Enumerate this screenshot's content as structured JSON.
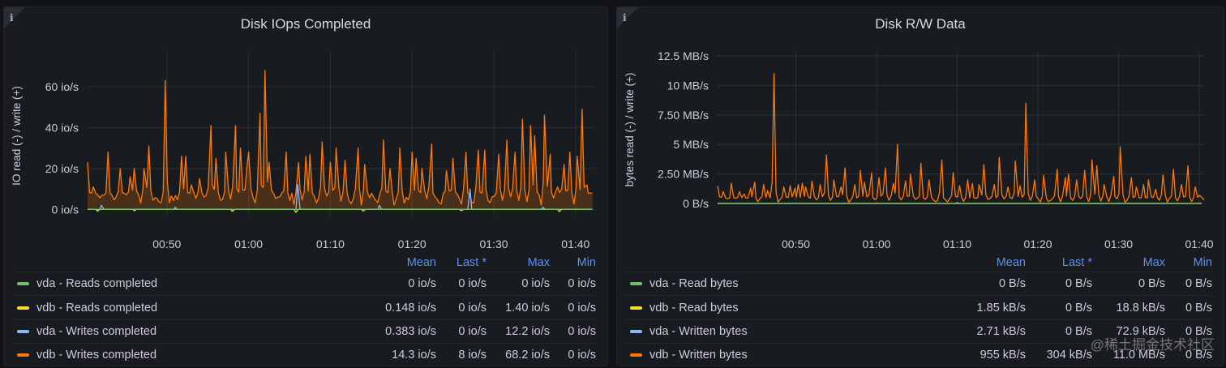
{
  "panels": [
    {
      "title": "Disk IOps Completed",
      "y_label": "IO read (-) / write (+)",
      "legend_headers": {
        "mean": "Mean",
        "last": "Last *",
        "max": "Max",
        "min": "Min"
      },
      "series": [
        {
          "name": "vda - Reads completed",
          "color": "#73bf69",
          "mean": "0 io/s",
          "last": "0 io/s",
          "max": "0 io/s",
          "min": "0 io/s"
        },
        {
          "name": "vdb - Reads completed",
          "color": "#fade2a",
          "mean": "0.148 io/s",
          "last": "0 io/s",
          "max": "1.40 io/s",
          "min": "0 io/s"
        },
        {
          "name": "vda - Writes completed",
          "color": "#8ab8ff",
          "mean": "0.383 io/s",
          "last": "0 io/s",
          "max": "12.2 io/s",
          "min": "0 io/s"
        },
        {
          "name": "vdb - Writes completed",
          "color": "#ff780a",
          "mean": "14.3 io/s",
          "last": "8 io/s",
          "max": "68.2 io/s",
          "min": "0 io/s"
        }
      ]
    },
    {
      "title": "Disk R/W Data",
      "y_label": "bytes read (-) / write (+)",
      "legend_headers": {
        "mean": "Mean",
        "last": "Last *",
        "max": "Max",
        "min": "Min"
      },
      "series": [
        {
          "name": "vda - Read bytes",
          "color": "#73bf69",
          "mean": "0 B/s",
          "last": "0 B/s",
          "max": "0 B/s",
          "min": "0 B/s"
        },
        {
          "name": "vdb - Read bytes",
          "color": "#fade2a",
          "mean": "1.85 kB/s",
          "last": "0 B/s",
          "max": "18.8 kB/s",
          "min": "0 B/s"
        },
        {
          "name": "vda - Written bytes",
          "color": "#8ab8ff",
          "mean": "2.71 kB/s",
          "last": "0 B/s",
          "max": "72.9 kB/s",
          "min": "0 B/s"
        },
        {
          "name": "vdb - Written bytes",
          "color": "#ff780a",
          "mean": "955 kB/s",
          "last": "304 kB/s",
          "max": "11.0 MB/s",
          "min": "0 B/s"
        }
      ]
    }
  ],
  "chart_data": [
    {
      "type": "area",
      "title": "Disk IOps Completed",
      "ylabel": "IO read (-) / write (+)",
      "y_ticks": [
        "0 io/s",
        "20 io/s",
        "40 io/s",
        "60 io/s"
      ],
      "ylim": [
        -3,
        75
      ],
      "x_ticks": [
        "00:50",
        "01:00",
        "01:10",
        "01:20",
        "01:30",
        "01:40"
      ],
      "x_tick_minutes": [
        50,
        60,
        70,
        80,
        90,
        100
      ],
      "xlim": [
        40.2,
        102.3
      ],
      "series": [
        {
          "name": "vdb - Writes completed",
          "color": "#ff780a",
          "fill": true,
          "peaks": [
            [
              40.3,
              23
            ],
            [
              41.0,
              11
            ],
            [
              42.8,
              28
            ],
            [
              44.3,
              20
            ],
            [
              45.5,
              16
            ],
            [
              46.0,
              20
            ],
            [
              47.2,
              20
            ],
            [
              47.8,
              31
            ],
            [
              49.8,
              63
            ],
            [
              51.8,
              26
            ],
            [
              52.3,
              26
            ],
            [
              53.0,
              12
            ],
            [
              54.0,
              15
            ],
            [
              55.4,
              41
            ],
            [
              56.0,
              25
            ],
            [
              57.2,
              28
            ],
            [
              58.4,
              41
            ],
            [
              59.0,
              30
            ],
            [
              59.8,
              21
            ],
            [
              60.0,
              28
            ],
            [
              61.4,
              47
            ],
            [
              62.0,
              68
            ],
            [
              62.5,
              23
            ],
            [
              64.6,
              28
            ],
            [
              66.1,
              23
            ],
            [
              67.0,
              26
            ],
            [
              67.5,
              27
            ],
            [
              69.0,
              33
            ],
            [
              70.0,
              23
            ],
            [
              70.7,
              30
            ],
            [
              71.8,
              24
            ],
            [
              73.4,
              30
            ],
            [
              74.2,
              22
            ],
            [
              76.5,
              34
            ],
            [
              77.3,
              20
            ],
            [
              78.5,
              30
            ],
            [
              80.0,
              28
            ],
            [
              80.5,
              25
            ],
            [
              81.2,
              20
            ],
            [
              82.4,
              32
            ],
            [
              84.2,
              19
            ],
            [
              85.0,
              25
            ],
            [
              86.6,
              28
            ],
            [
              88.1,
              29
            ],
            [
              88.9,
              29
            ],
            [
              90.6,
              27
            ],
            [
              91.6,
              34
            ],
            [
              92.6,
              28
            ],
            [
              93.5,
              44
            ],
            [
              94.5,
              41
            ],
            [
              95.0,
              36
            ],
            [
              96.2,
              46
            ],
            [
              96.9,
              27
            ],
            [
              97.8,
              11
            ],
            [
              98.6,
              22
            ],
            [
              99.3,
              28
            ],
            [
              100.2,
              26
            ],
            [
              100.8,
              49
            ],
            [
              101.4,
              12
            ]
          ],
          "baseline_range": [
            2,
            8
          ],
          "last_value": 8
        },
        {
          "name": "vda - Writes completed",
          "color": "#8ab8ff",
          "fill": false,
          "peaks": [
            [
              42.0,
              2
            ],
            [
              51.0,
              1
            ],
            [
              66.0,
              12.2
            ],
            [
              76.0,
              2
            ],
            [
              87.1,
              10
            ],
            [
              96.0,
              1
            ]
          ],
          "last_value": 0
        },
        {
          "name": "vdb - Reads completed",
          "color": "#fade2a",
          "fill": false,
          "peaks": [
            [
              41.5,
              -0.8
            ],
            [
              46.0,
              -0.6
            ],
            [
              58.0,
              -0.9
            ],
            [
              65.8,
              -1.4
            ],
            [
              74.0,
              -0.7
            ],
            [
              86.0,
              -0.6
            ],
            [
              98.0,
              -1.0
            ]
          ],
          "last_value": 0
        },
        {
          "name": "vda - Reads completed",
          "color": "#73bf69",
          "fill": false,
          "peaks": [
            [
              40.3,
              0
            ]
          ],
          "last_value": 0
        }
      ]
    },
    {
      "type": "line",
      "title": "Disk R/W Data",
      "ylabel": "bytes read (-) / write (+)",
      "y_ticks": [
        "0 B/s",
        "2.50 MB/s",
        "5 MB/s",
        "7.50 MB/s",
        "10 MB/s",
        "12.5 MB/s"
      ],
      "ylim": [
        0,
        12.5
      ],
      "y_unit": "MB/s",
      "x_ticks": [
        "00:50",
        "01:00",
        "01:10",
        "01:20",
        "01:30",
        "01:40"
      ],
      "x_tick_minutes": [
        50,
        60,
        70,
        80,
        90,
        100
      ],
      "xlim": [
        40.2,
        100.6
      ],
      "series": [
        {
          "name": "vdb - Written bytes",
          "color": "#ff780a",
          "fill": false,
          "peaks": [
            [
              40.3,
              1.5
            ],
            [
              41.0,
              1.0
            ],
            [
              42.0,
              1.7
            ],
            [
              43.0,
              1.0
            ],
            [
              43.6,
              0.8
            ],
            [
              44.4,
              1.3
            ],
            [
              44.9,
              1.8
            ],
            [
              46.0,
              1.6
            ],
            [
              46.5,
              1.1
            ],
            [
              47.3,
              11.0
            ],
            [
              48.5,
              1.4
            ],
            [
              49.3,
              1.5
            ],
            [
              49.9,
              1.3
            ],
            [
              50.3,
              1.6
            ],
            [
              50.8,
              1.7
            ],
            [
              51.2,
              1.4
            ],
            [
              52.0,
              1.9
            ],
            [
              53.0,
              1.6
            ],
            [
              53.8,
              4.1
            ],
            [
              54.7,
              2.0
            ],
            [
              55.6,
              1.4
            ],
            [
              56.1,
              3.0
            ],
            [
              57.3,
              1.6
            ],
            [
              58.0,
              2.8
            ],
            [
              58.5,
              1.8
            ],
            [
              59.4,
              2.6
            ],
            [
              60.3,
              2.2
            ],
            [
              61.1,
              3.0
            ],
            [
              62.1,
              1.7
            ],
            [
              62.6,
              5.0
            ],
            [
              63.6,
              1.9
            ],
            [
              64.2,
              2.5
            ],
            [
              65.5,
              3.4
            ],
            [
              66.5,
              2.0
            ],
            [
              68.1,
              3.7
            ],
            [
              69.5,
              2.6
            ],
            [
              70.3,
              1.5
            ],
            [
              71.3,
              2.0
            ],
            [
              71.9,
              1.7
            ],
            [
              72.7,
              1.6
            ],
            [
              73.3,
              3.3
            ],
            [
              74.6,
              1.6
            ],
            [
              75.2,
              3.9
            ],
            [
              76.3,
              1.4
            ],
            [
              77.2,
              3.6
            ],
            [
              77.8,
              1.5
            ],
            [
              78.5,
              8.5
            ],
            [
              79.6,
              2.0
            ],
            [
              80.7,
              2.4
            ],
            [
              82.4,
              2.9
            ],
            [
              83.4,
              2.2
            ],
            [
              83.8,
              2.5
            ],
            [
              84.8,
              2.0
            ],
            [
              85.8,
              2.8
            ],
            [
              86.7,
              3.7
            ],
            [
              87.3,
              3.2
            ],
            [
              88.2,
              1.6
            ],
            [
              89.4,
              2.3
            ],
            [
              90.2,
              4.8
            ],
            [
              91.6,
              2.2
            ],
            [
              92.2,
              1.4
            ],
            [
              93.1,
              1.6
            ],
            [
              93.7,
              2.0
            ],
            [
              94.6,
              1.2
            ],
            [
              95.5,
              2.4
            ],
            [
              96.8,
              2.9
            ],
            [
              97.8,
              1.6
            ],
            [
              98.6,
              3.2
            ],
            [
              99.5,
              1.4
            ],
            [
              100.2,
              2.3
            ],
            [
              100.6,
              1.6
            ]
          ],
          "baseline_range": [
            0.1,
            0.45
          ],
          "last_value": 0.304
        },
        {
          "name": "vda - Written bytes",
          "color": "#8ab8ff",
          "fill": false,
          "peaks": [
            [
              70.0,
              0.0729
            ]
          ],
          "last_value": 0
        },
        {
          "name": "vdb - Read bytes",
          "color": "#fade2a",
          "fill": false,
          "peaks": [
            [
              60.0,
              0.0188
            ]
          ],
          "last_value": 0
        },
        {
          "name": "vda - Read bytes",
          "color": "#73bf69",
          "fill": false,
          "peaks": [
            [
              40.3,
              0
            ]
          ],
          "last_value": 0
        }
      ]
    }
  ],
  "watermark": "@稀土掘金技术社区",
  "colors": {
    "background": "#111217",
    "panel": "#181b1f",
    "grid": "#2c2f35",
    "legend_header": "#5b8ff2"
  },
  "icons": {
    "panel_info": "info-icon"
  }
}
